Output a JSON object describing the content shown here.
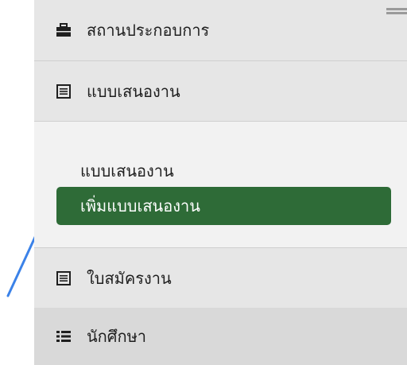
{
  "sidebar": {
    "items": [
      {
        "label": "สถานประกอบการ",
        "icon": "briefcase-icon"
      },
      {
        "label": "แบบเสนองาน",
        "icon": "list-icon"
      },
      {
        "label": "ใบสมัครงาน",
        "icon": "list-icon"
      },
      {
        "label": "นักศึกษา",
        "icon": "list-ul-icon"
      }
    ],
    "submenu": {
      "link_label": "แบบเสนองาน",
      "active_label": "เพิ่มแบบเสนองาน",
      "active_color": "#2e6b37"
    }
  },
  "annotation": {
    "arrow_color": "#3b82e8"
  }
}
